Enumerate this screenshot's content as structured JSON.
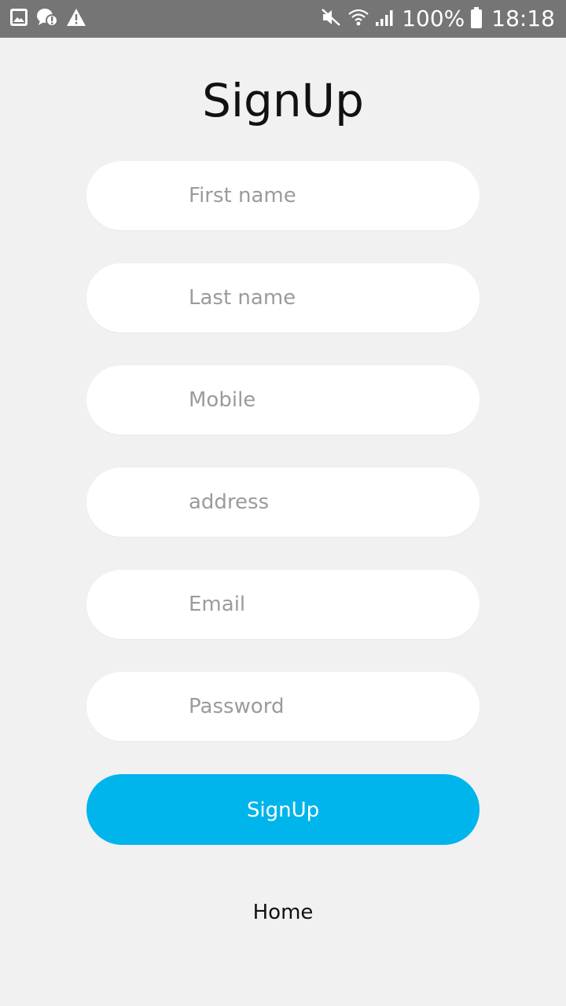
{
  "status_bar": {
    "left_icons": [
      "gallery-icon",
      "chat-alert-icon",
      "warning-icon"
    ],
    "right_icons": [
      "mute-icon",
      "wifi-icon",
      "signal-icon",
      "battery-icon"
    ],
    "battery_percent": "100%",
    "time": "18:18",
    "background_color": "#757575"
  },
  "page": {
    "title": "SignUp"
  },
  "form": {
    "fields": [
      {
        "name": "first_name",
        "placeholder": "First name",
        "value": ""
      },
      {
        "name": "last_name",
        "placeholder": "Last name",
        "value": ""
      },
      {
        "name": "mobile",
        "placeholder": "Mobile",
        "value": ""
      },
      {
        "name": "address",
        "placeholder": "address",
        "value": ""
      },
      {
        "name": "email",
        "placeholder": "Email",
        "value": ""
      },
      {
        "name": "password",
        "placeholder": "Password",
        "value": ""
      }
    ],
    "submit_label": "SignUp",
    "accent_color": "#00b4ec"
  },
  "footer": {
    "home_label": "Home"
  }
}
